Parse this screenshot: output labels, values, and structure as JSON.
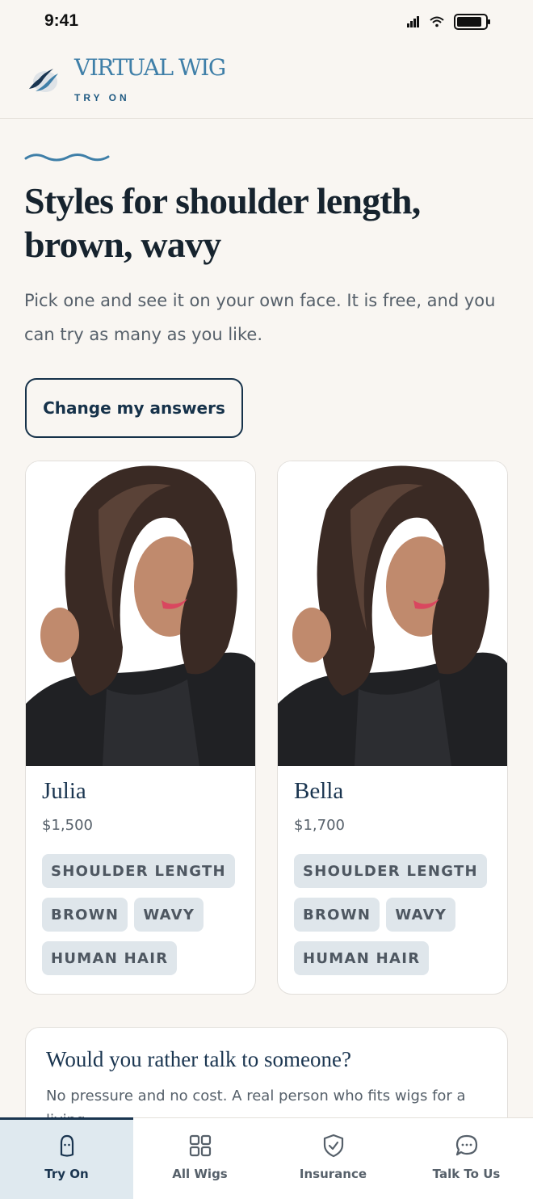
{
  "status": {
    "time": "9:41"
  },
  "brand": {
    "name": "VIRTUAL WIG",
    "subtitle": "TRY ON"
  },
  "page": {
    "title": "Styles for shoulder length, brown, wavy",
    "intro": "Pick one and see it on your own face. It is free, and you can try as many as you like.",
    "change_answers_label": "Change my answers"
  },
  "styles": [
    {
      "name": "Julia",
      "price": "$1,500",
      "tags": [
        "SHOULDER LENGTH",
        "BROWN",
        "WAVY",
        "HUMAN HAIR"
      ]
    },
    {
      "name": "Bella",
      "price": "$1,700",
      "tags": [
        "SHOULDER LENGTH",
        "BROWN",
        "WAVY",
        "HUMAN HAIR"
      ]
    }
  ],
  "talk": {
    "title": "Would you rather talk to someone?",
    "body": "No pressure and no cost. A real person who fits wigs for a living"
  },
  "tabs": [
    {
      "label": "Try On",
      "icon": "face-icon",
      "active": true
    },
    {
      "label": "All Wigs",
      "icon": "grid-icon",
      "active": false
    },
    {
      "label": "Insurance",
      "icon": "shield-check-icon",
      "active": false
    },
    {
      "label": "Talk To Us",
      "icon": "chat-bubble-icon",
      "active": false
    }
  ],
  "colors": {
    "accent": "#3f7fa8",
    "navy": "#1a3550",
    "background": "#f9f6f2",
    "tag_bg": "#dfe6eb"
  }
}
